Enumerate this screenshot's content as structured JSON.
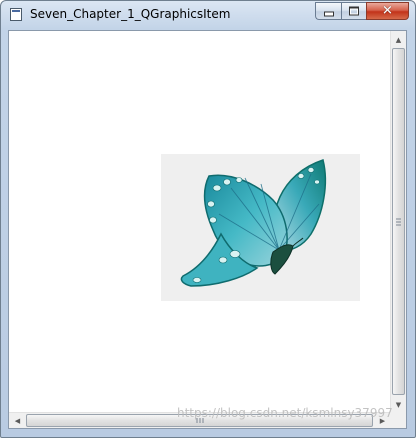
{
  "window": {
    "title": "Seven_Chapter_1_QGraphicsItem",
    "app_icon": "window-app-icon",
    "controls": {
      "minimize_icon": "minimize-icon",
      "maximize_icon": "maximize-icon",
      "close_icon": "close-icon",
      "close_glyph": "✕"
    }
  },
  "scene": {
    "item_kind": "pixmap",
    "image_subject": "butterfly",
    "item_background": "#efefef",
    "butterfly_colors": [
      "#2aa7b8",
      "#1b8fa1",
      "#53c9c9",
      "#a7d8e0",
      "#0f6b6e",
      "#1b7f5a"
    ]
  },
  "scrollbars": {
    "vertical": {
      "up_arrow": "▲",
      "down_arrow": "▼"
    },
    "horizontal": {
      "left_arrow": "◀",
      "right_arrow": "▶"
    }
  },
  "watermark": "https://blog.csdn.net/ksmlnsy37997"
}
